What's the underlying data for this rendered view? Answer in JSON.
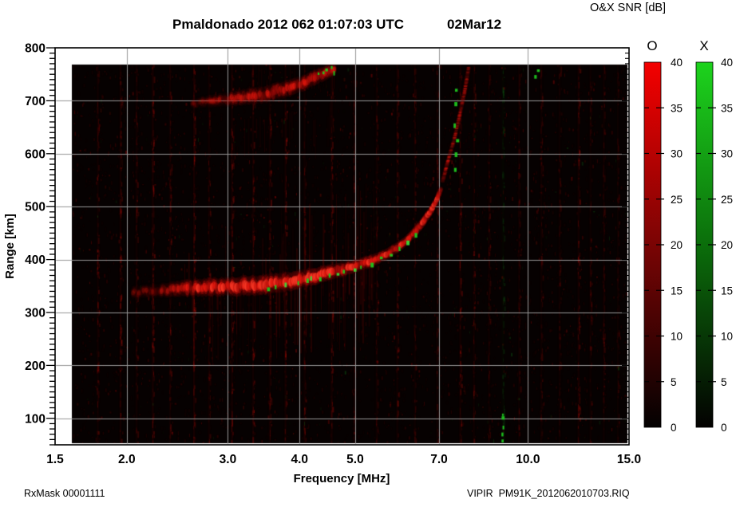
{
  "header": {
    "title": "Pmaldonado 2012 062 01:07:03 UTC",
    "date": "02Mar12"
  },
  "colorbar": {
    "title": "O&X SNR [dB]",
    "o_label": "O",
    "x_label": "X",
    "range": [
      0,
      40
    ],
    "tick_values": [
      40,
      35,
      30,
      25,
      20,
      15,
      10,
      5,
      0
    ],
    "tick_labels": [
      "40",
      "35",
      "30",
      "25",
      "20",
      "15",
      "10",
      "5",
      "0"
    ],
    "dashed_tick_values": [
      35,
      30,
      25,
      20,
      15,
      10,
      5
    ],
    "o_color_top": "#f40000",
    "o_color_mid": "#7a0404",
    "x_color_top": "#1dd31d",
    "x_color_mid": "#0b6e0b",
    "color_bottom": "#030101"
  },
  "footer": {
    "left": "RxMask 00001111",
    "right": "VIPIR  PM91K_2012062010703.RIQ"
  },
  "chart_data": {
    "type": "heatmap",
    "title": "Pmaldonado 2012 062 01:07:03 UTC  02Mar12",
    "xlabel": "Frequency [MHz]",
    "ylabel": "Range [km]",
    "x_scale": "log",
    "x_range": [
      1.5,
      15
    ],
    "y_range": [
      50,
      800
    ],
    "x_ticks": [
      {
        "v": 1.5,
        "label": "1.5"
      },
      {
        "v": 2.0,
        "label": "2.0"
      },
      {
        "v": 3.0,
        "label": "3.0"
      },
      {
        "v": 4.0,
        "label": "4.0"
      },
      {
        "v": 5.0,
        "label": "5.0"
      },
      {
        "v": 7.0,
        "label": "7.0"
      },
      {
        "v": 10.0,
        "label": "10.0"
      },
      {
        "v": 15.0,
        "label": "15.0"
      }
    ],
    "y_ticks": [
      {
        "v": 800,
        "label": "800"
      },
      {
        "v": 700,
        "label": "700"
      },
      {
        "v": 600,
        "label": "600"
      },
      {
        "v": 500,
        "label": "500"
      },
      {
        "v": 400,
        "label": "400"
      },
      {
        "v": 300,
        "label": "300"
      },
      {
        "v": 200,
        "label": "200"
      },
      {
        "v": 100,
        "label": "100"
      }
    ],
    "y_minor_tick_step": 10,
    "grid": true,
    "grid_x_values": [
      2,
      3,
      4,
      5,
      7,
      10
    ],
    "grid_y_values": [
      700,
      600,
      500,
      400,
      300,
      200,
      100
    ],
    "grid_color": "#969696",
    "legend": "O trace = red scale 0-40 dB, X trace = green scale 0-40 dB",
    "data_region": {
      "f_start": 1.6,
      "f_end": 15.0,
      "r_start": 50,
      "r_end": 768
    },
    "o_trace_main": [
      [
        2.05,
        338,
        10,
        0.2
      ],
      [
        2.3,
        342,
        11,
        0.26
      ],
      [
        2.55,
        346,
        13,
        0.75
      ],
      [
        2.8,
        348,
        14,
        0.95
      ],
      [
        3.0,
        349,
        14,
        0.88
      ],
      [
        3.2,
        350,
        15,
        0.95
      ],
      [
        3.5,
        353,
        15,
        1.0
      ],
      [
        3.75,
        357,
        15,
        0.95
      ],
      [
        4.0,
        363,
        14,
        1.0
      ],
      [
        4.25,
        369,
        13,
        0.95
      ],
      [
        4.5,
        375,
        12,
        0.95
      ],
      [
        4.75,
        381,
        11,
        0.9
      ],
      [
        5.0,
        387,
        10,
        0.9
      ],
      [
        5.25,
        395,
        10,
        0.85
      ],
      [
        5.5,
        403,
        9,
        0.8
      ],
      [
        5.75,
        414,
        9,
        0.75
      ],
      [
        6.0,
        427,
        8,
        0.8
      ],
      [
        6.2,
        440,
        8,
        0.8
      ],
      [
        6.4,
        456,
        8,
        0.85
      ],
      [
        6.6,
        474,
        8,
        0.9
      ],
      [
        6.8,
        495,
        7,
        0.9
      ],
      [
        6.95,
        515,
        6,
        0.85
      ],
      [
        7.05,
        532,
        5,
        0.65
      ]
    ],
    "o_trace_asymptote": [
      [
        7.1,
        548,
        3,
        0.5
      ],
      [
        7.25,
        585,
        3,
        0.5
      ],
      [
        7.45,
        630,
        2.5,
        0.45
      ],
      [
        7.6,
        672,
        2.5,
        0.45
      ],
      [
        7.75,
        715,
        2.5,
        0.5
      ],
      [
        7.88,
        762,
        2.5,
        0.45
      ]
    ],
    "o_trace_second_hop": [
      [
        2.6,
        695,
        8,
        0.14
      ],
      [
        2.85,
        700,
        10,
        0.28
      ],
      [
        3.1,
        705,
        12,
        0.42
      ],
      [
        3.35,
        710,
        13,
        0.5
      ],
      [
        3.6,
        716,
        13,
        0.5
      ],
      [
        3.85,
        724,
        13,
        0.55
      ],
      [
        4.05,
        733,
        12,
        0.6
      ],
      [
        4.25,
        743,
        12,
        0.62
      ],
      [
        4.45,
        753,
        11,
        0.6
      ],
      [
        4.6,
        761,
        10,
        0.5
      ]
    ],
    "x_dots_main": [
      [
        3.5,
        350
      ],
      [
        3.62,
        352
      ],
      [
        3.78,
        355
      ],
      [
        3.95,
        359
      ],
      [
        4.12,
        363
      ],
      [
        4.18,
        366
      ],
      [
        4.32,
        368
      ],
      [
        4.5,
        373
      ],
      [
        4.62,
        377
      ],
      [
        4.78,
        381
      ],
      [
        4.95,
        386
      ],
      [
        5.12,
        391
      ],
      [
        5.3,
        397
      ],
      [
        5.5,
        403
      ],
      [
        5.72,
        412
      ],
      [
        5.95,
        423
      ],
      [
        6.15,
        435
      ],
      [
        6.35,
        449
      ]
    ],
    "x_dots_asymptote": [
      [
        7.44,
        575
      ],
      [
        7.45,
        600
      ],
      [
        7.46,
        628
      ],
      [
        7.44,
        660
      ],
      [
        7.45,
        700
      ],
      [
        7.46,
        722
      ]
    ],
    "x_dots_second_hop": [
      [
        4.32,
        752
      ],
      [
        4.4,
        758
      ],
      [
        4.45,
        764
      ],
      [
        4.52,
        768
      ],
      [
        4.58,
        755
      ]
    ],
    "x_dots_sporadic": [
      [
        9.0,
        58
      ],
      [
        9.02,
        72
      ],
      [
        9.05,
        88
      ],
      [
        9.03,
        102
      ],
      [
        9.0,
        112
      ],
      [
        10.3,
        750
      ],
      [
        10.32,
        760
      ]
    ],
    "interference_columns": [
      {
        "f": 1.78,
        "i": 0.1
      },
      {
        "f": 1.95,
        "i": 0.13
      },
      {
        "f": 2.08,
        "i": 0.09
      },
      {
        "f": 2.22,
        "i": 0.14
      },
      {
        "f": 2.38,
        "i": 0.1
      },
      {
        "f": 2.62,
        "i": 0.16
      },
      {
        "f": 2.78,
        "i": 0.1
      },
      {
        "f": 3.05,
        "i": 0.13
      },
      {
        "f": 3.32,
        "i": 0.12
      },
      {
        "f": 3.55,
        "i": 0.1
      },
      {
        "f": 3.78,
        "i": 0.13
      },
      {
        "f": 4.08,
        "i": 0.1
      },
      {
        "f": 4.55,
        "i": 0.12
      },
      {
        "f": 4.98,
        "i": 0.11
      },
      {
        "f": 5.45,
        "i": 0.09
      },
      {
        "f": 5.92,
        "i": 0.1
      },
      {
        "f": 6.35,
        "i": 0.08
      },
      {
        "f": 6.95,
        "i": 0.09
      },
      {
        "f": 7.62,
        "i": 0.12
      },
      {
        "f": 8.05,
        "i": 0.09
      },
      {
        "f": 8.55,
        "i": 0.08
      },
      {
        "f": 9.05,
        "i": 0.07,
        "c": "green"
      },
      {
        "f": 9.65,
        "i": 0.08
      },
      {
        "f": 10.55,
        "i": 0.08
      },
      {
        "f": 11.35,
        "i": 0.07
      },
      {
        "f": 12.25,
        "i": 0.12
      },
      {
        "f": 12.85,
        "i": 0.07
      },
      {
        "f": 13.55,
        "i": 0.08
      },
      {
        "f": 14.35,
        "i": 0.07
      }
    ],
    "noise": {
      "speckle_count": 3800,
      "green_fraction": 0.05,
      "spread_streaks": 110,
      "second_hop_streaks": 30
    }
  }
}
